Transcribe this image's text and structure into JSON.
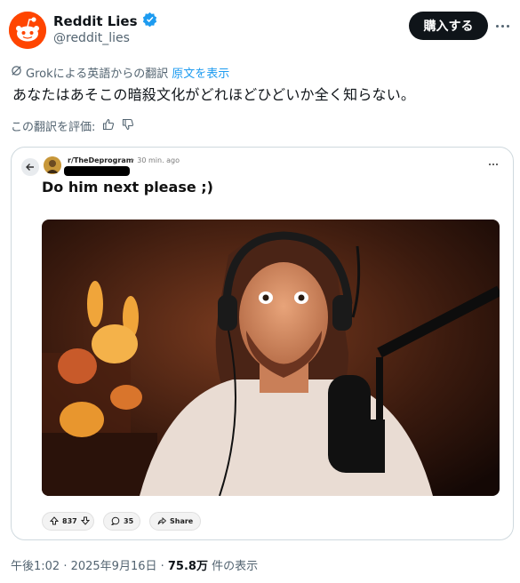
{
  "account": {
    "name": "Reddit Lies",
    "handle": "@reddit_lies",
    "buy_label": "購入する"
  },
  "translation": {
    "notice": "Grokによる英語からの翻訳",
    "show_original": "原文を表示",
    "text": "あなたはあそこの暗殺文化がどれほどひどいか全く知らない。",
    "rate_label": "この翻訳を評価:"
  },
  "embedded_post": {
    "subreddit": "r/TheDeprogram",
    "time": "• 30 min. ago",
    "title": "Do him next please ;)",
    "upvotes": "837",
    "comments": "35",
    "share_label": "Share"
  },
  "footer": {
    "datetime": "午後1:02 · 2025年9月16日 · ",
    "views": "75.8万",
    "views_suffix": " 件の表示"
  },
  "colors": {
    "reddit_orange": "#ff4500",
    "verified_blue": "#1d9bf0",
    "text": "#0f1419",
    "muted": "#536471"
  }
}
